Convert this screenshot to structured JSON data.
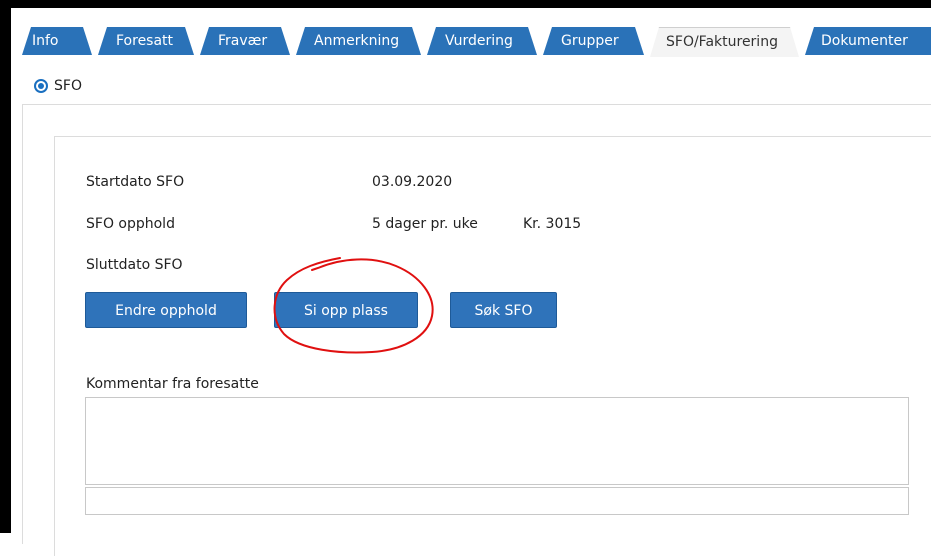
{
  "tabs": [
    {
      "label": "Info"
    },
    {
      "label": "Foresatt"
    },
    {
      "label": "Fravær"
    },
    {
      "label": "Anmerkning"
    },
    {
      "label": "Vurdering"
    },
    {
      "label": "Grupper"
    },
    {
      "label": "SFO/Fakturering"
    },
    {
      "label": "Dokumenter"
    }
  ],
  "active_tab": "SFO/Fakturering",
  "radio": {
    "label": "SFO",
    "checked": true
  },
  "fields": {
    "startdato_label": "Startdato SFO",
    "startdato_value": "03.09.2020",
    "opphold_label": "SFO opphold",
    "opphold_value": "5 dager pr. uke",
    "opphold_price": "Kr. 3015",
    "sluttdato_label": "Sluttdato SFO"
  },
  "buttons": {
    "endre": "Endre opphold",
    "siopp": "Si opp plass",
    "sok": "Søk SFO"
  },
  "comment": {
    "label": "Kommentar fra foresatte",
    "value": ""
  },
  "colors": {
    "tab_blue": "#2a72b8",
    "button_blue": "#2f73ba",
    "annotation_red": "#e01010"
  }
}
